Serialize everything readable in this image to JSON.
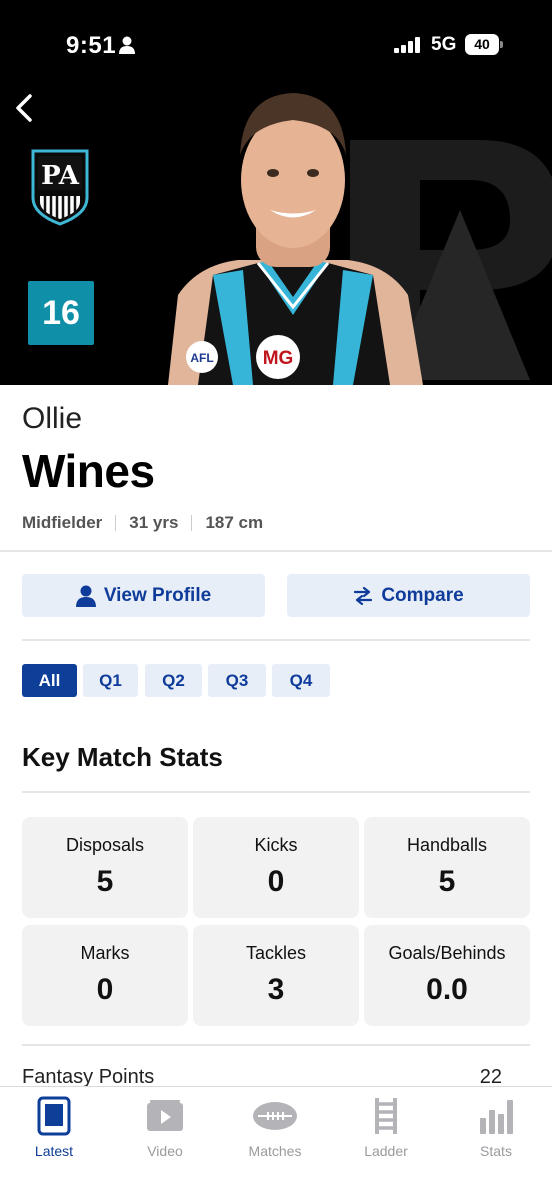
{
  "status_bar": {
    "time": "9:51",
    "network": "5G",
    "battery": "40"
  },
  "player": {
    "first_name": "Ollie",
    "last_name": "Wines",
    "jersey_number": "16",
    "position": "Midfielder",
    "age": "31 yrs",
    "height": "187 cm",
    "sponsor_badge": "MG",
    "league_badge": "AFL"
  },
  "actions": {
    "view_profile": "View Profile",
    "compare": "Compare"
  },
  "quarters": {
    "all": "All",
    "q1": "Q1",
    "q2": "Q2",
    "q3": "Q3",
    "q4": "Q4",
    "selected": "All"
  },
  "key_stats": {
    "title": "Key Match Stats",
    "items": [
      {
        "label": "Disposals",
        "value": "5"
      },
      {
        "label": "Kicks",
        "value": "0"
      },
      {
        "label": "Handballs",
        "value": "5"
      },
      {
        "label": "Marks",
        "value": "0"
      },
      {
        "label": "Tackles",
        "value": "3"
      },
      {
        "label": "Goals/Behinds",
        "value": "0.0"
      }
    ]
  },
  "fantasy": {
    "label": "Fantasy Points",
    "value": "22"
  },
  "bottom_nav": {
    "latest": "Latest",
    "video": "Video",
    "matches": "Matches",
    "ladder": "Ladder",
    "stats": "Stats",
    "active": "Latest"
  },
  "colors": {
    "accent": "#0d3e98",
    "club_teal": "#0f8fa8",
    "card_bg": "#f2f2f3",
    "button_bg": "#e8eef8"
  }
}
